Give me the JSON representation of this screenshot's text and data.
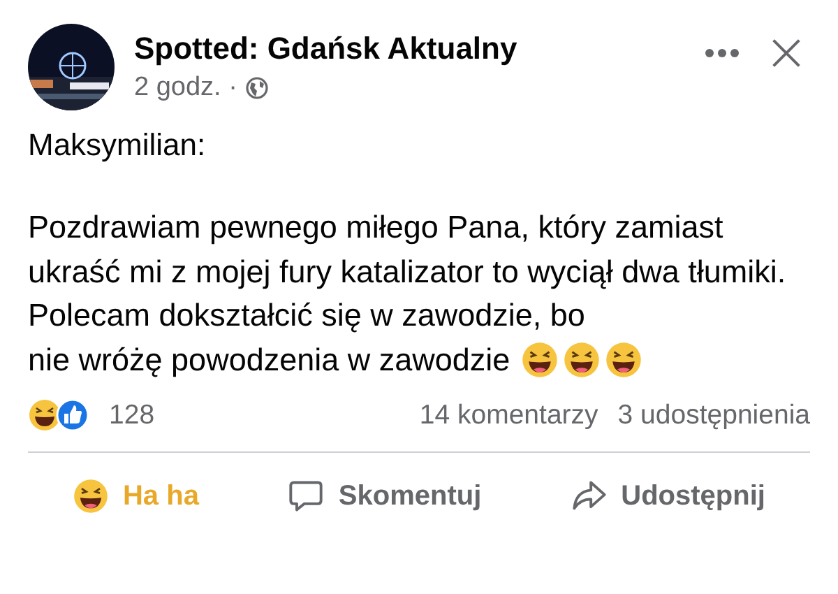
{
  "post": {
    "page_name": "Spotted: Gdańsk Aktualny",
    "time": "2 godz. ·",
    "author": "Maksymilian:",
    "body": "Pozdrawiam pewnego miłego Pana, który zamiast ukraść mi z mojej fury katalizator to wyciął dwa tłumiki. Polecam dokształcić się w zawodzie, bo",
    "body_end": "nie wróżę powodzenia w zawodzie"
  },
  "stats": {
    "reactions": "128",
    "comments": "14 komentarzy",
    "shares": "3 udostępnienia"
  },
  "actions": [
    {
      "kind": "react",
      "label": "Ha ha",
      "selected": true
    },
    {
      "kind": "comment",
      "label": "Skomentuj",
      "selected": false
    },
    {
      "kind": "share",
      "label": "Udostępnij",
      "selected": false
    }
  ]
}
